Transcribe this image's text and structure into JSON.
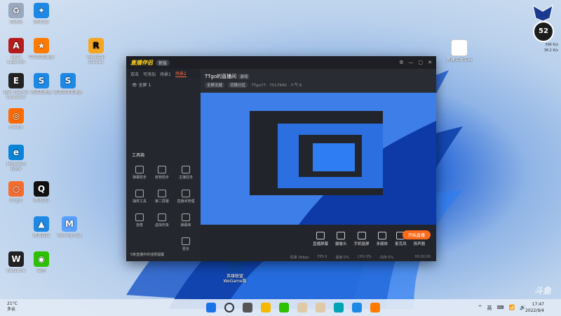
{
  "desktop": {
    "icons": [
      {
        "label": "回收站",
        "x": 0,
        "y": 0,
        "color": "#9aa9bf",
        "glyph": "♻"
      },
      {
        "label": "腾讯QQ",
        "x": 0,
        "y": 0,
        "color": "#1e88e5",
        "glyph": "✦"
      },
      {
        "label": "Apex Legends",
        "x": 0,
        "y": 0,
        "color": "#b71c1c",
        "glyph": "A"
      },
      {
        "label": "中文网加速器",
        "x": 0,
        "y": 0,
        "color": "#ff7a00",
        "glyph": "★"
      },
      {
        "label": "Rockstar Games",
        "x": 0,
        "y": 0,
        "color": "#f5a623",
        "glyph": "R"
      },
      {
        "label": "Epic Games Launcher",
        "x": 0,
        "y": 0,
        "color": "#222",
        "glyph": "E"
      },
      {
        "label": "迅游加速器",
        "x": 0,
        "y": 0,
        "color": "#1e88e5",
        "glyph": "S"
      },
      {
        "label": "迅游网游加速器",
        "x": 0,
        "y": 0,
        "color": "#1e88e5",
        "glyph": "S"
      },
      {
        "label": "Firefox",
        "x": 0,
        "y": 0,
        "color": "#ff6a00",
        "glyph": "◎"
      },
      {
        "label": "Microsoft Edge",
        "x": 0,
        "y": 0,
        "color": "#0a84d6",
        "glyph": "e"
      },
      {
        "label": "Origin",
        "x": 0,
        "y": 0,
        "color": "#f56c2d",
        "glyph": "○"
      },
      {
        "label": "腾讯QQ",
        "x": 0,
        "y": 0,
        "color": "#111",
        "glyph": "Q"
      },
      {
        "label": "腾讯会议",
        "x": 0,
        "y": 0,
        "color": "#1e88e5",
        "glyph": "▲"
      },
      {
        "label": "Moving Out",
        "x": 0,
        "y": 0,
        "color": "#5aa0ff",
        "glyph": "M"
      },
      {
        "label": "WeGame",
        "x": 0,
        "y": 0,
        "color": "#222",
        "glyph": "W"
      },
      {
        "label": "微信",
        "x": 0,
        "y": 0,
        "color": "#2dc100",
        "glyph": "◉"
      },
      {
        "label": "新建文本文档",
        "x": 0,
        "y": 0,
        "color": "#ffffff",
        "glyph": ""
      },
      {
        "label": "英雄联盟 WeGame版",
        "x": 0,
        "y": 0,
        "color": "#0d47a1",
        "glyph": ""
      }
    ],
    "watermark": "斗鱼"
  },
  "app": {
    "title_logo": "直播伴侣",
    "version_badge": "新版",
    "tabs": [
      "双击",
      "可添加",
      "场景1",
      "场景2"
    ],
    "scene_label": "全屏 1",
    "tools_header": "工具箱",
    "tools": [
      "弹幕助手",
      "房管助手",
      "主播任务",
      "抽奖工具",
      "第二屏幕",
      "直播间管理",
      "连麦",
      "虚拟形象",
      "弹幕库",
      "更多"
    ],
    "room_title": "TTgo的直播间",
    "room_tag": "游戏",
    "category_pill": "全屏无缝",
    "category_pill2": "切换分区",
    "stats": "TTgo77 · 7517840 · 人气 6",
    "controls": [
      "直播屏幕",
      "摄像头",
      "手机投屏",
      "多媒体",
      "麦克风",
      "扬声器"
    ],
    "go_live_label": "开始直播",
    "status_items": [
      "码率 0kbps",
      "FPS 0",
      "丢帧 0%",
      "CPU 0%",
      "内存 0%"
    ],
    "live_timer": "00:00:00",
    "sidebar_notice": "5条直播中的违规提醒"
  },
  "taskbar": {
    "weather_temp": "21°C",
    "weather_desc": "多云",
    "tray_items": [
      "^",
      "英",
      "⌨",
      "📶",
      "🔊"
    ],
    "time": "17:47",
    "date": "2022/9/4",
    "speed_value": "52",
    "speed_up": "396 K/s",
    "speed_down": "38.2 K/s"
  }
}
